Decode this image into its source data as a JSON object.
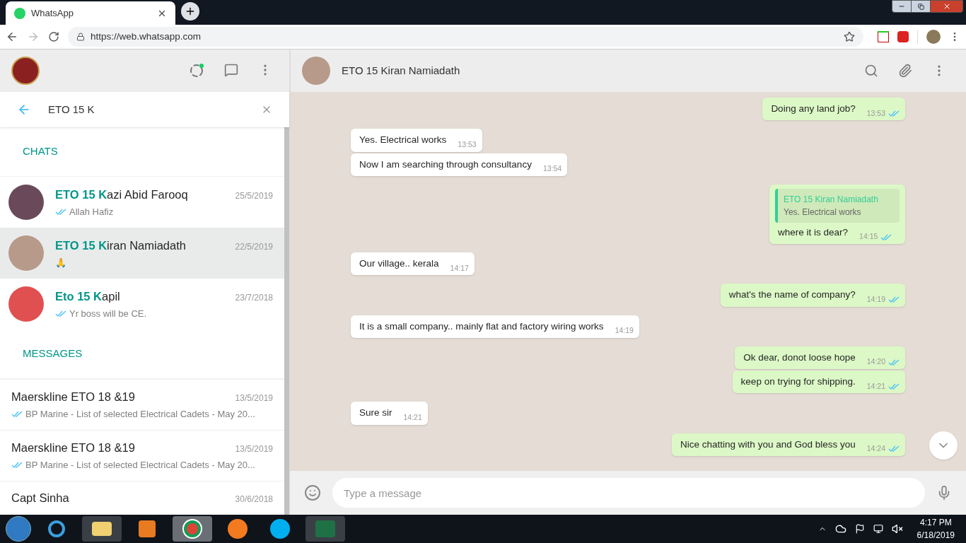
{
  "browser": {
    "tab": {
      "title": "WhatsApp"
    },
    "url": "https://web.whatsapp.com"
  },
  "search": {
    "value": "ETO 15 K"
  },
  "sections": [
    {
      "title": "CHATS",
      "kind": "chats",
      "items": [
        {
          "name": "**ETO 15 K**azi Abid Farooq",
          "date": "25/5/2019",
          "preview": "Allah Hafiz",
          "read": true,
          "selected": false
        },
        {
          "name": "**ETO 15 K**iran Namiadath",
          "date": "22/5/2019",
          "preview": "🙏",
          "read": false,
          "selected": true
        },
        {
          "name": "**Eto 15 K**apil",
          "date": "23/7/2018",
          "preview": "Yr boss will be CE.",
          "read": true,
          "selected": false
        }
      ]
    },
    {
      "title": "MESSAGES",
      "kind": "messages",
      "items": [
        {
          "name": "Maerskline ETO 18 &19",
          "date": "13/5/2019",
          "preview": "BP Marine - List of selected Electrical Cadets - May 20...",
          "read": true,
          "selected": false
        },
        {
          "name": "Maerskline ETO 18 &19",
          "date": "13/5/2019",
          "preview": "BP Marine - List of selected Electrical Cadets - May 20...",
          "read": true,
          "selected": false
        },
        {
          "name": "Capt Sinha",
          "date": "30/6/2018",
          "selected": false
        }
      ]
    }
  ],
  "chat": {
    "title": "ETO 15 Kiran Namiadath",
    "messages": [
      {
        "kind": "out",
        "text": "Doing any land job?",
        "time": "13:53",
        "read": true
      },
      {
        "kind": "in",
        "text": "Yes. Electrical works",
        "time": "13:53"
      },
      {
        "kind": "in",
        "text": "Now I am searching through consultancy",
        "time": "13:54"
      },
      {
        "kind": "out",
        "quote": {
          "author": "ETO 15 Kiran Namiadath",
          "text": "Yes. Electrical works"
        },
        "text": "where it is dear?",
        "time": "14:15",
        "read": true
      },
      {
        "kind": "in",
        "text": "Our village.. kerala",
        "time": "14:17"
      },
      {
        "kind": "out",
        "text": "what's the name of company?",
        "time": "14:19",
        "read": true
      },
      {
        "kind": "in",
        "text": "It is a small company.. mainly flat and factory wiring works",
        "time": "14:19"
      },
      {
        "kind": "out",
        "text": "Ok dear, donot loose hope",
        "time": "14:20",
        "read": true
      },
      {
        "kind": "out",
        "text": "keep on trying for shipping.",
        "time": "14:21",
        "read": true
      },
      {
        "kind": "in",
        "text": "Sure sir",
        "time": "14:21"
      },
      {
        "kind": "out",
        "text": "Nice chatting with you and God bless you",
        "time": "14:24",
        "read": true
      }
    ],
    "composer": {
      "placeholder": "Type a message"
    }
  },
  "taskbar": {
    "time": "4:17 PM",
    "date": "6/18/2019"
  }
}
